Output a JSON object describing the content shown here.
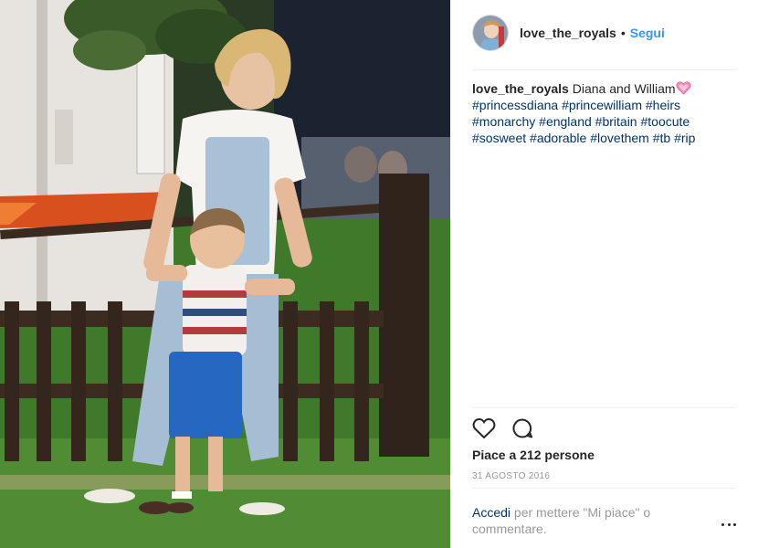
{
  "post": {
    "username": "love_the_royals",
    "separator": "•",
    "follow_label": "Segui",
    "photo_description": "Diana and William",
    "caption": {
      "username": "love_the_royals",
      "text": "Diana and William",
      "emoji_icon": "sparkling-heart-icon",
      "hashtags": [
        "#princessdiana",
        "#princewilliam",
        "#heirs",
        "#monarchy",
        "#england",
        "#britain",
        "#toocute",
        "#sosweet",
        "#adorable",
        "#lovethem",
        "#tb",
        "#rip"
      ]
    },
    "actions": {
      "like_icon": "heart-outline-icon",
      "comment_icon": "comment-bubble-icon"
    },
    "likes_text": "Piace a 212 persone",
    "date": "31 AGOSTO 2016",
    "login": {
      "link": "Accedi",
      "text": "per mettere \"Mi piace\" o commentare."
    },
    "more_icon": "more-options-icon"
  },
  "colors": {
    "link_blue": "#3897f0",
    "hashtag_blue": "#003569",
    "muted_gray": "#999999",
    "text": "#262626"
  }
}
